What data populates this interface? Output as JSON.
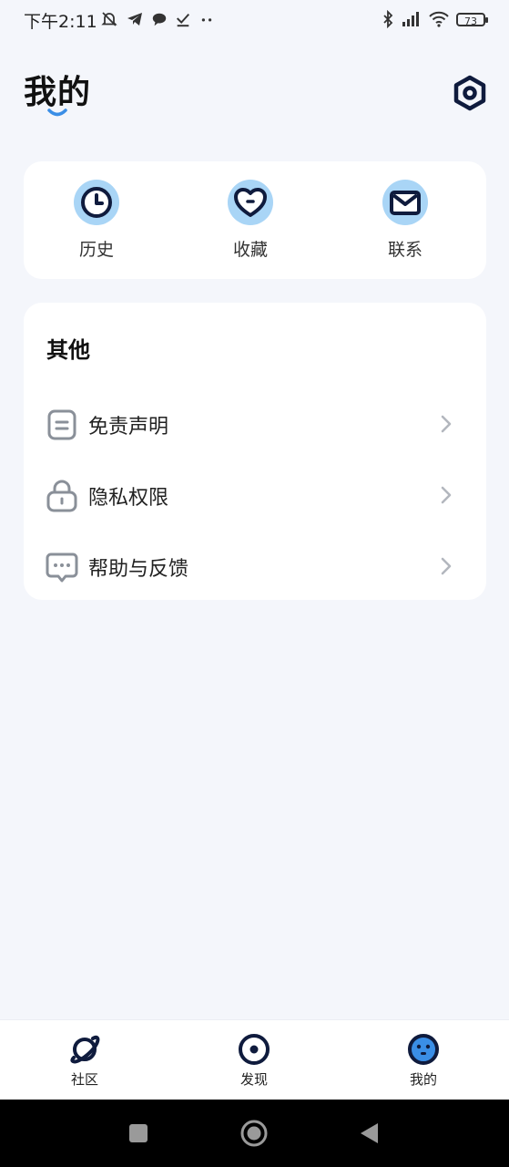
{
  "status_bar": {
    "time": "下午2:11",
    "battery": "73"
  },
  "header": {
    "title": "我的"
  },
  "quick_actions": [
    {
      "label": "历史",
      "icon": "clock-icon"
    },
    {
      "label": "收藏",
      "icon": "heart-icon"
    },
    {
      "label": "联系",
      "icon": "mail-icon"
    }
  ],
  "other": {
    "title": "其他",
    "items": [
      {
        "label": "免责声明",
        "icon": "document-icon"
      },
      {
        "label": "隐私权限",
        "icon": "lock-icon"
      },
      {
        "label": "帮助与反馈",
        "icon": "chat-bubble-icon"
      }
    ]
  },
  "bottom_nav": {
    "items": [
      {
        "label": "社区",
        "icon": "planet-icon"
      },
      {
        "label": "发现",
        "icon": "eye-icon"
      },
      {
        "label": "我的",
        "icon": "face-icon",
        "active": true
      }
    ]
  },
  "colors": {
    "accent_light": "#a9d5f6",
    "accent": "#3a8ee6",
    "dark_navy": "#0f1b3d",
    "background": "#f4f6fb"
  }
}
